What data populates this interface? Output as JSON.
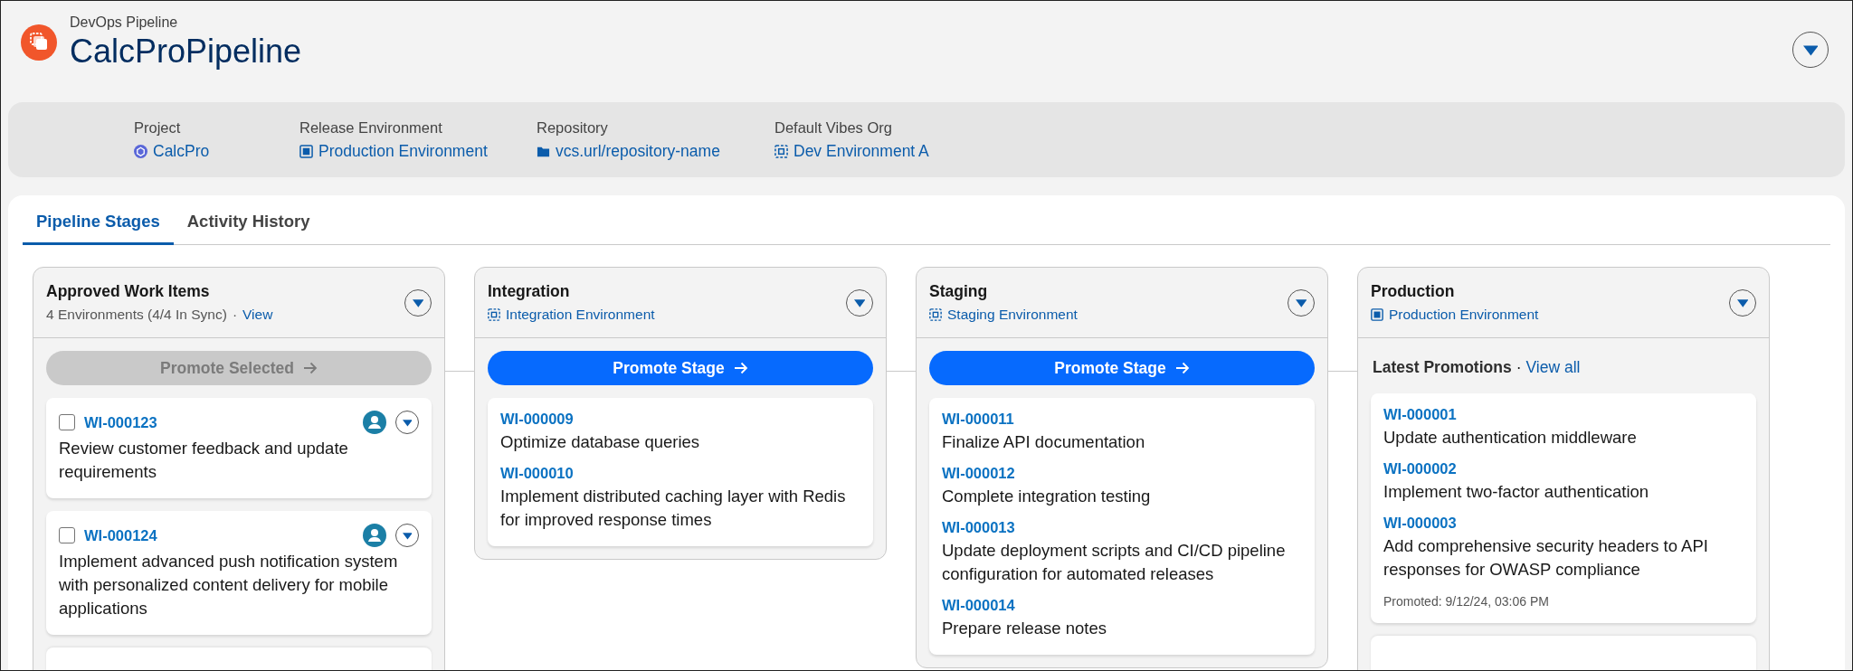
{
  "header": {
    "subtitle": "DevOps Pipeline",
    "title": "CalcProPipeline"
  },
  "details": [
    {
      "label": "Project",
      "value": "CalcPro",
      "kind": "project"
    },
    {
      "label": "Release Environment",
      "value": "Production Environment",
      "kind": "production"
    },
    {
      "label": "Repository",
      "value": "vcs.url/repository-name",
      "kind": "repository"
    },
    {
      "label": "Default Vibes Org",
      "value": "Dev Environment A",
      "kind": "sandbox"
    }
  ],
  "tabs": [
    {
      "label": "Pipeline Stages",
      "selected": true
    },
    {
      "label": "Activity History",
      "selected": false
    }
  ],
  "stages": [
    {
      "kind": "approved",
      "title": "Approved Work Items",
      "summary": "4 Environments (4/4 In Sync)",
      "summary_separator": "·",
      "summary_link": "View",
      "button": {
        "label": "Promote Selected",
        "disabled": true
      },
      "more_below": true,
      "cards": [
        {
          "checked": false,
          "items": [
            {
              "id": "WI-000123",
              "description": "Review customer feedback and update requirements"
            }
          ]
        },
        {
          "checked": false,
          "items": [
            {
              "id": "WI-000124",
              "description": "Implement advanced push notification system with personalized content delivery for mobile applications"
            }
          ]
        }
      ]
    },
    {
      "kind": "stage",
      "title": "Integration",
      "environment": {
        "name": "Integration Environment",
        "kind": "sandbox"
      },
      "button": {
        "label": "Promote Stage",
        "disabled": false
      },
      "cards": [
        {
          "items": [
            {
              "id": "WI-000009",
              "description": "Optimize database queries"
            },
            {
              "id": "WI-000010",
              "description": "Implement distributed caching layer with Redis for improved response times"
            }
          ]
        }
      ]
    },
    {
      "kind": "stage",
      "title": "Staging",
      "environment": {
        "name": "Staging Environment",
        "kind": "sandbox"
      },
      "button": {
        "label": "Promote Stage",
        "disabled": false
      },
      "cards": [
        {
          "items": [
            {
              "id": "WI-000011",
              "description": "Finalize API documentation"
            },
            {
              "id": "WI-000012",
              "description": "Complete integration testing"
            },
            {
              "id": "WI-000013",
              "description": "Update deployment scripts and CI/CD pipeline configuration for automated releases"
            },
            {
              "id": "WI-000014",
              "description": "Prepare release notes"
            }
          ]
        }
      ]
    },
    {
      "kind": "production",
      "title": "Production",
      "environment": {
        "name": "Production Environment",
        "kind": "production"
      },
      "latest_label": "Latest Promotions",
      "latest_separator": "·",
      "latest_link": "View all",
      "more_below": true,
      "cards": [
        {
          "items": [
            {
              "id": "WI-000001",
              "description": "Update authentication middleware"
            },
            {
              "id": "WI-000002",
              "description": "Implement two-factor authentication"
            },
            {
              "id": "WI-000003",
              "description": "Add comprehensive security headers to API responses for OWASP compliance"
            }
          ],
          "promoted": "Promoted: 9/12/24, 03:06 PM"
        }
      ]
    }
  ]
}
